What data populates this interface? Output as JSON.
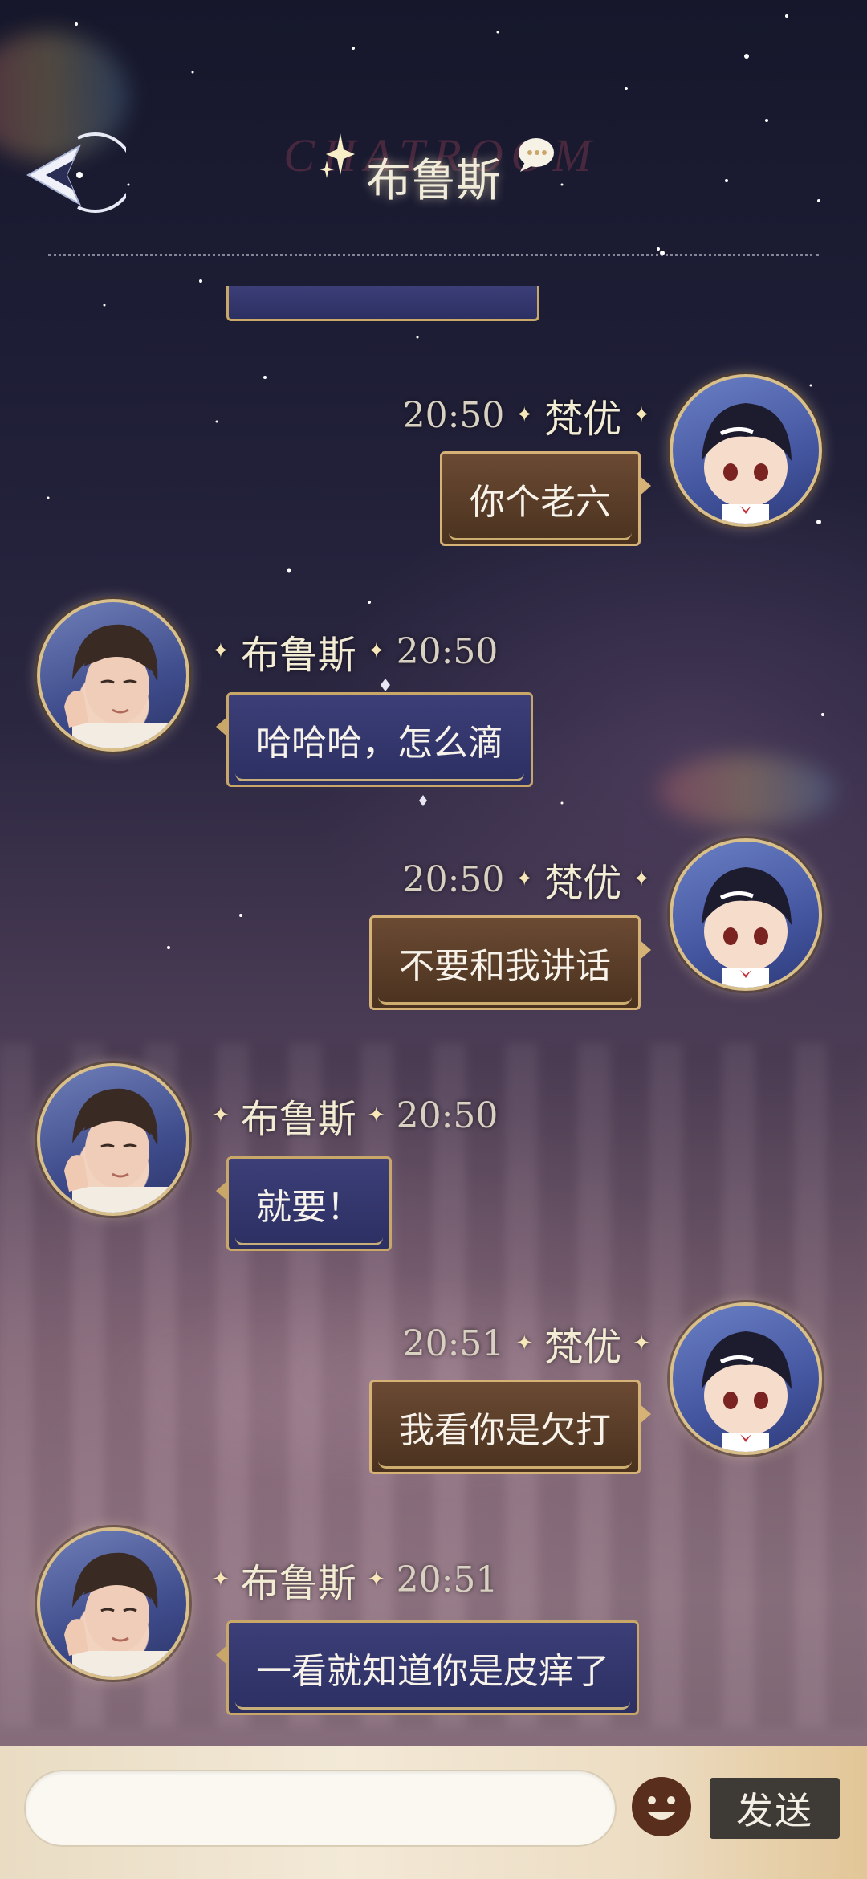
{
  "header": {
    "watermark": "CHATROOM",
    "title": "布鲁斯",
    "back_icon": "back-arrow-icon",
    "chat_icon": "speech-bubble-icon"
  },
  "contacts": {
    "other": "布鲁斯",
    "me": "梵优"
  },
  "messages": [
    {
      "sender": "梵优",
      "time": "20:50",
      "text": "你个老六",
      "side": "right"
    },
    {
      "sender": "布鲁斯",
      "time": "20:50",
      "text": "哈哈哈，怎么滴",
      "side": "left"
    },
    {
      "sender": "梵优",
      "time": "20:50",
      "text": "不要和我讲话",
      "side": "right"
    },
    {
      "sender": "布鲁斯",
      "time": "20:50",
      "text": "就要！",
      "side": "left"
    },
    {
      "sender": "梵优",
      "time": "20:51",
      "text": "我看你是欠打",
      "side": "right"
    },
    {
      "sender": "布鲁斯",
      "time": "20:51",
      "text": "一看就知道你是皮痒了",
      "side": "left"
    }
  ],
  "input": {
    "value": "",
    "placeholder": "",
    "emoji_icon": "smiley-face-icon",
    "send_label": "发送"
  },
  "colors": {
    "bubble_left": "#2f3268",
    "bubble_right": "#5a3d28",
    "bubble_border": "#d6b276",
    "send_button": "#3e3a36"
  }
}
